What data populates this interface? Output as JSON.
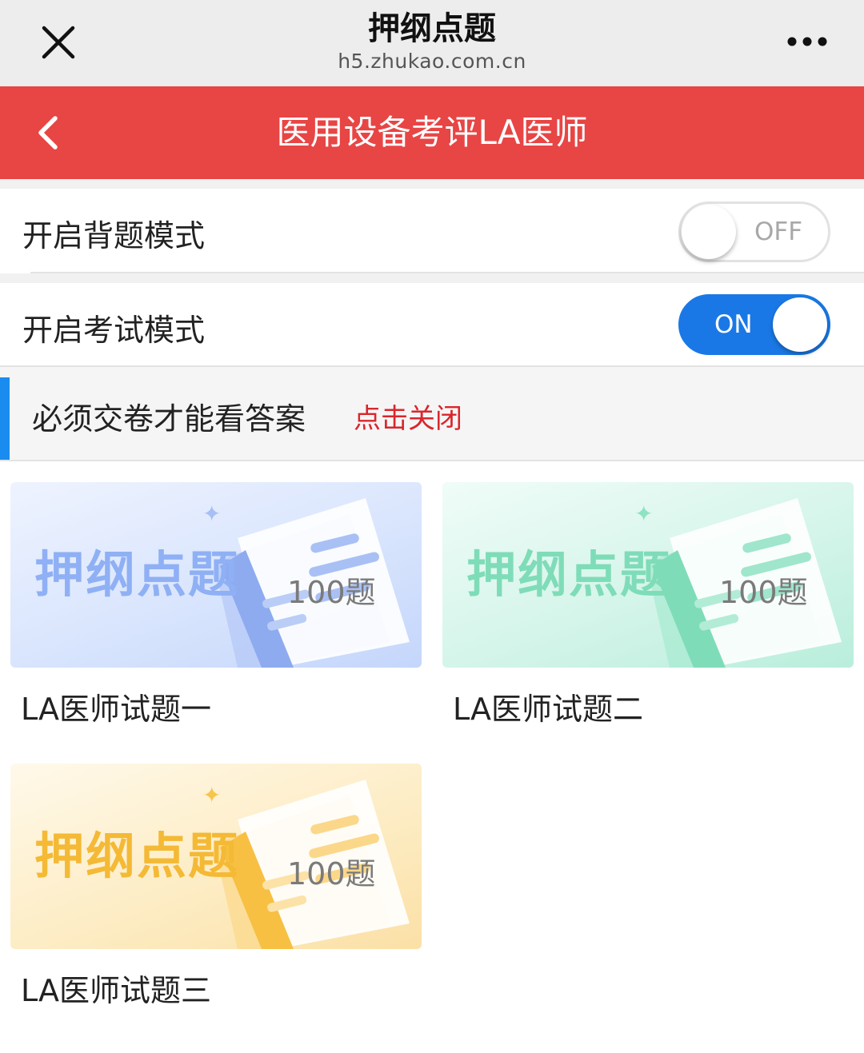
{
  "browser": {
    "title": "押纲点题",
    "url": "h5.zhukao.com.cn",
    "close_icon": "close-icon",
    "more_icon": "more-horizontal-icon"
  },
  "header": {
    "title": "医用设备考评LA医师",
    "back_icon": "chevron-left-icon",
    "color": "#e84545"
  },
  "settings": {
    "recite_mode": {
      "label": "开启背题模式",
      "state": "OFF"
    },
    "exam_mode": {
      "label": "开启考试模式",
      "state": "ON"
    },
    "toggle_on_color": "#1a78e6"
  },
  "notice": {
    "text": "必须交卷才能看答案",
    "link": "点击关闭",
    "accent_color": "#1a8cf0",
    "link_color": "#d9262c"
  },
  "exams": [
    {
      "banner": "押纲点题",
      "count": "100题",
      "caption": "LA医师试题一",
      "theme": "blue"
    },
    {
      "banner": "押纲点题",
      "count": "100题",
      "caption": "LA医师试题二",
      "theme": "green"
    },
    {
      "banner": "押纲点题",
      "count": "100题",
      "caption": "LA医师试题三",
      "theme": "yellow"
    }
  ]
}
